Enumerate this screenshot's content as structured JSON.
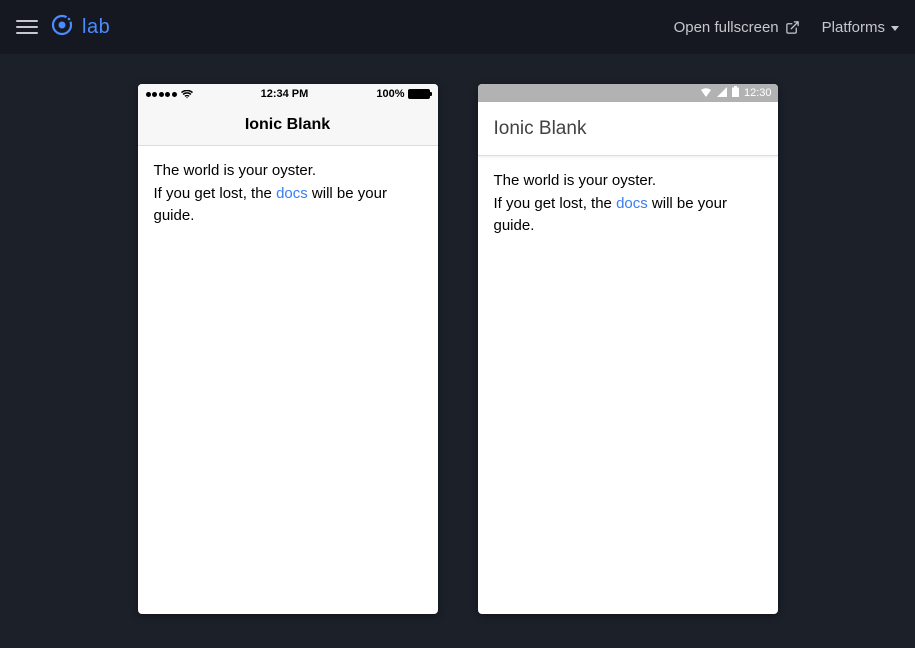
{
  "topbar": {
    "logo_text": "lab",
    "fullscreen_label": "Open fullscreen",
    "platforms_label": "Platforms"
  },
  "ios": {
    "statusbar": {
      "time": "12:34 PM",
      "battery_pct": "100%"
    },
    "header_title": "Ionic Blank",
    "body_line1": "The world is your oyster.",
    "body_line2_prefix": "If you get lost, the ",
    "body_docs": "docs",
    "body_line2_suffix": " will be your guide."
  },
  "android": {
    "statusbar": {
      "time": "12:30"
    },
    "header_title": "Ionic Blank",
    "body_line1": "The world is your oyster.",
    "body_line2_prefix": "If you get lost, the ",
    "body_docs": "docs",
    "body_line2_suffix": " will be your guide."
  }
}
